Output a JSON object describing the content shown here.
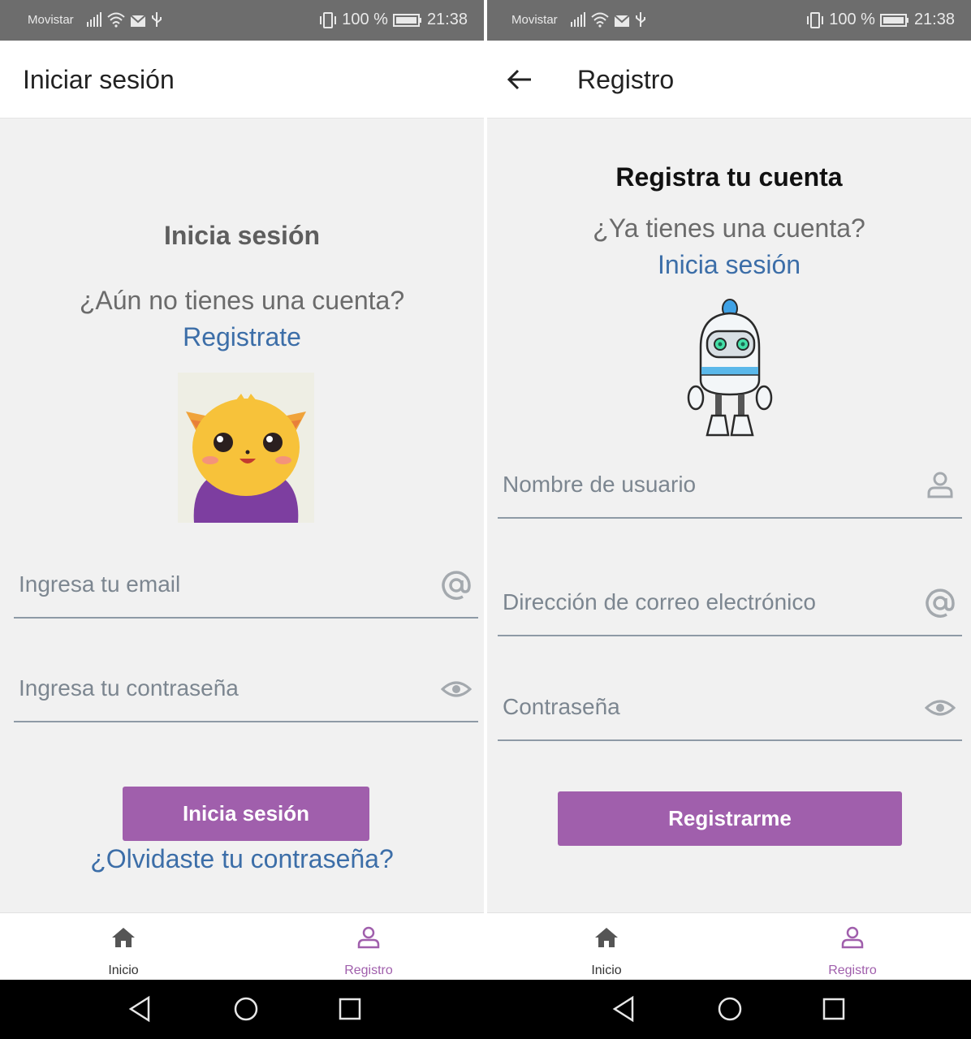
{
  "status": {
    "carrier": "Movistar",
    "battery": "100 %",
    "time": "21:38"
  },
  "login": {
    "appbar_title": "Iniciar sesión",
    "heading": "Inicia sesión",
    "question": "¿Aún no tienes una cuenta?",
    "register_link": "Registrate",
    "email_placeholder": "Ingresa tu email",
    "password_placeholder": "Ingresa tu contraseña",
    "submit_label": "Inicia sesión",
    "forgot_link": "¿Olvidaste tu contraseña?"
  },
  "register": {
    "appbar_title": "Registro",
    "heading": "Registra tu cuenta",
    "question": "¿Ya tienes una cuenta?",
    "login_link": "Inicia sesión",
    "username_placeholder": "Nombre de usuario",
    "email_placeholder": "Dirección de correo electrónico",
    "password_placeholder": "Contraseña",
    "submit_label": "Registrarme"
  },
  "bottom_nav": {
    "home_label": "Inicio",
    "register_label": "Registro",
    "active_tab": "Registro"
  },
  "colors": {
    "accent": "#a05fac",
    "link": "#3c6ea8",
    "status_bar": "#6d6d6d"
  },
  "icons": {
    "back": "arrow-left-icon",
    "email": "at-sign-icon",
    "password": "eye-icon",
    "username": "user-icon",
    "home": "home-icon",
    "register": "user-icon"
  }
}
